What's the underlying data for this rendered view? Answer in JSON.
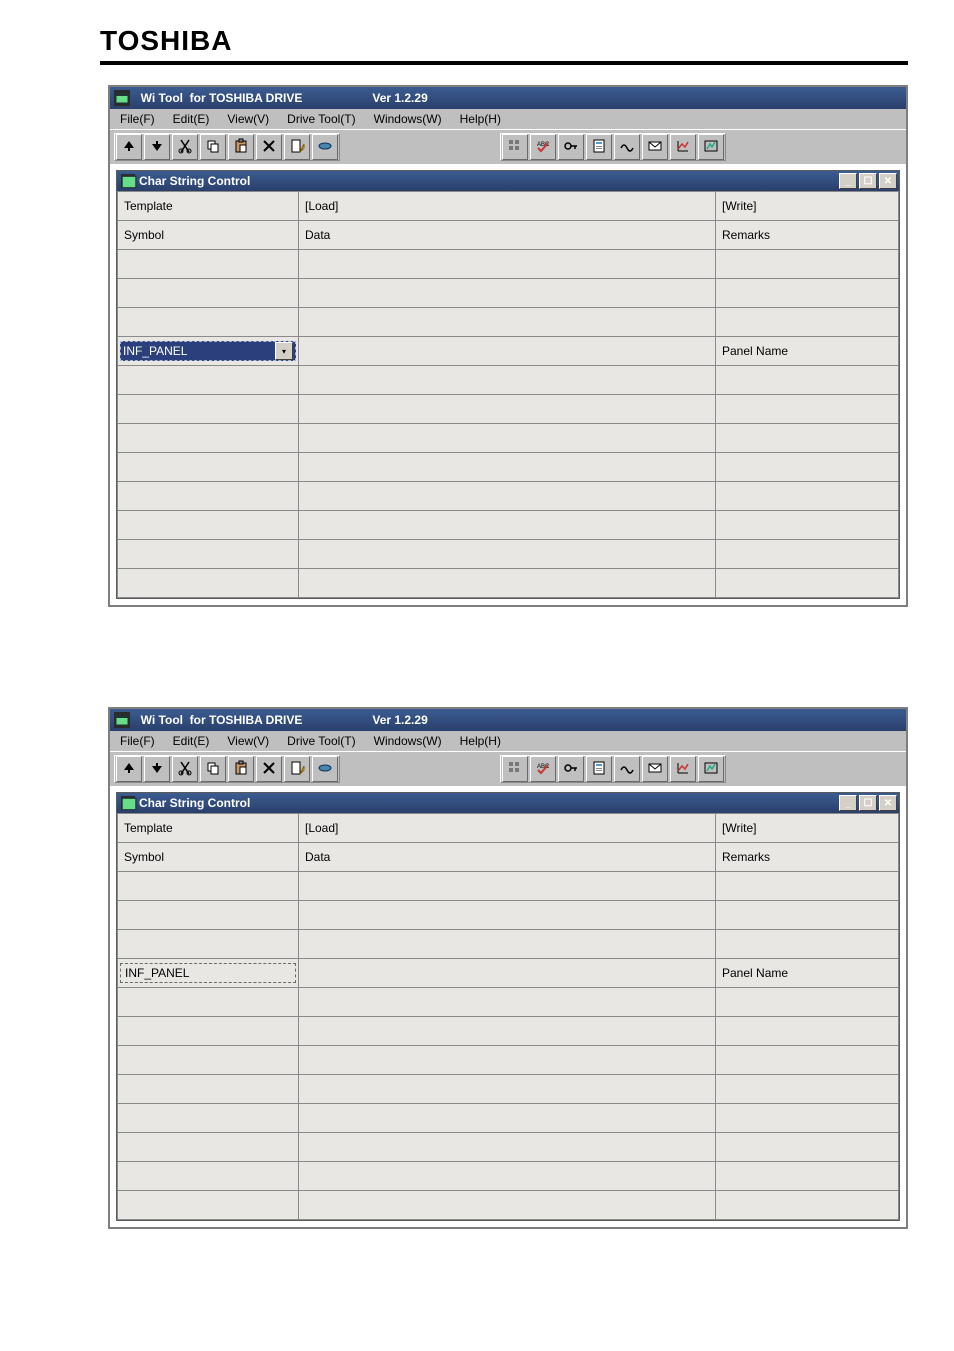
{
  "brand": "TOSHIBA",
  "app": {
    "title_prefix": "  Wi Tool  for TOSHIBA DRIVE",
    "title_spacer": "                     ",
    "version": "Ver 1.2.29"
  },
  "menu": {
    "file": "File(F)",
    "edit": "Edit(E)",
    "view": "View(V)",
    "drivetool": "Drive Tool(T)",
    "windows": "Windows(W)",
    "help": "Help(H)"
  },
  "child": {
    "title": "Char String Control"
  },
  "table": {
    "headers": {
      "template": "Template",
      "load": "[Load]",
      "write": "[Write]",
      "symbol": "Symbol",
      "data": "Data",
      "remarks": "Remarks"
    },
    "row_selected": {
      "symbol": "INF_PANEL",
      "data": "",
      "remarks": "Panel Name"
    },
    "blank": ""
  },
  "icons": {
    "up": "up-arrow",
    "down": "down-arrow",
    "cut": "cut",
    "copy": "copy",
    "paste": "paste",
    "delete": "delete",
    "new": "new",
    "print": "print",
    "grp1": "g1",
    "grp2": "g2",
    "grp3": "g3",
    "grp4": "g4",
    "grp5": "g5",
    "grp6": "g6",
    "grp7": "g7",
    "grp8": "g8"
  }
}
